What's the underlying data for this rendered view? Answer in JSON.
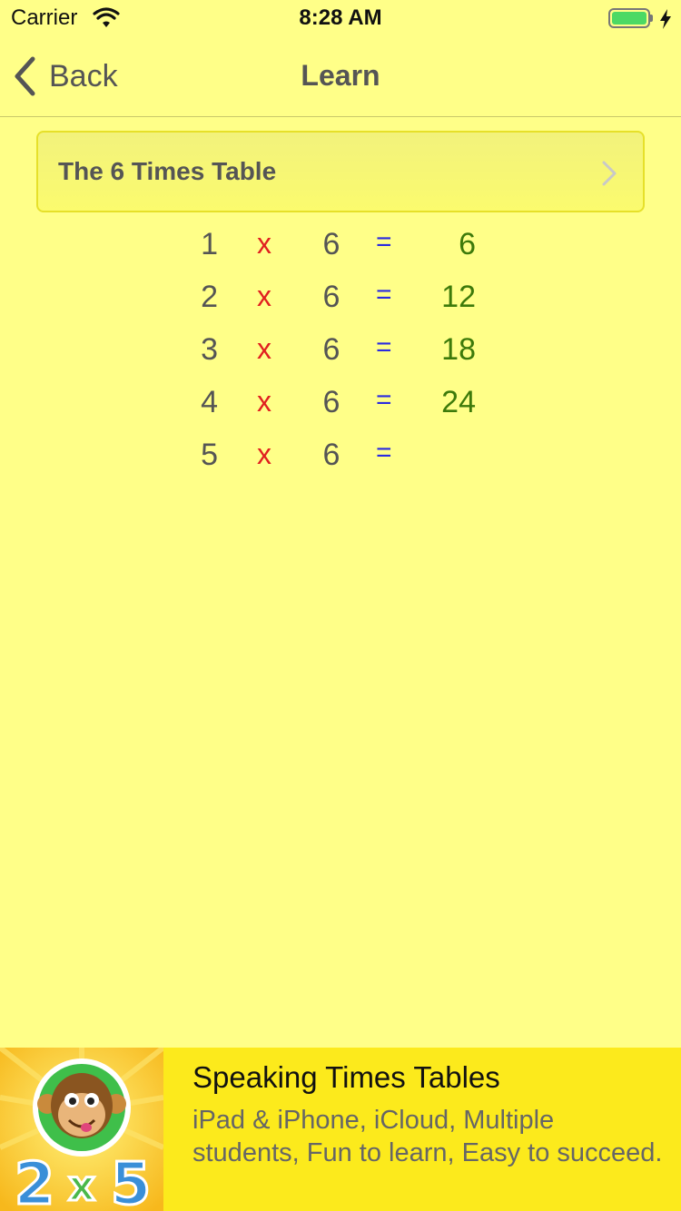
{
  "status_bar": {
    "carrier": "Carrier",
    "time": "8:28 AM",
    "battery_color": "#4cd964",
    "battery_level": 1.0
  },
  "nav": {
    "back_label": "Back",
    "title": "Learn"
  },
  "selector": {
    "label": "The 6 Times Table"
  },
  "times_table": {
    "operator": "x",
    "equals": "=",
    "rows": [
      {
        "multiplier": "1",
        "base": "6",
        "result": "6"
      },
      {
        "multiplier": "2",
        "base": "6",
        "result": "12"
      },
      {
        "multiplier": "3",
        "base": "6",
        "result": "18"
      },
      {
        "multiplier": "4",
        "base": "6",
        "result": "24"
      },
      {
        "multiplier": "5",
        "base": "6",
        "result": ""
      }
    ]
  },
  "ad": {
    "title": "Speaking Times Tables",
    "description": "iPad & iPhone, iCloud, Multiple students, Fun to learn, Easy to succeed.",
    "icon_name": "monkey-2x5-app-icon"
  },
  "colors": {
    "background": "#ffff88",
    "operator": "#e02020",
    "equals": "#2a2ae0",
    "result": "#3d7a0a",
    "ad_background": "#fcea1c"
  }
}
